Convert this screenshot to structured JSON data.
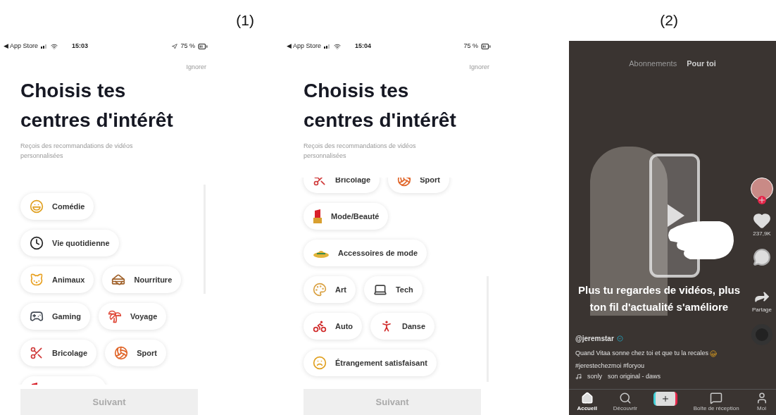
{
  "figure_labels": [
    "(1)",
    "(2)"
  ],
  "screens": [
    {
      "status": {
        "carrier": "◀ App Store",
        "time": "15:03",
        "location": true,
        "battery": "75 %"
      },
      "skip": "Ignorer",
      "title": [
        "Choisis tes",
        "centres d'intérêt"
      ],
      "subtitle": "Reçois des recommandations de vidéos personnalisées",
      "scrolled": false,
      "rows": [
        [
          {
            "label": "Comédie",
            "kind": "laugh"
          }
        ],
        [
          {
            "label": "Vie quotidienne",
            "kind": "clock"
          }
        ],
        [
          {
            "label": "Animaux",
            "kind": "cat"
          },
          {
            "label": "Nourriture",
            "kind": "burger"
          }
        ],
        [
          {
            "label": "Gaming",
            "kind": "gamepad"
          },
          {
            "label": "Voyage",
            "kind": "beach"
          }
        ],
        [
          {
            "label": "Bricolage",
            "kind": "scissors"
          },
          {
            "label": "Sport",
            "kind": "ball"
          }
        ],
        [
          {
            "kind": "lipstick"
          }
        ]
      ],
      "next": "Suivant"
    },
    {
      "status": {
        "carrier": "◀ App Store",
        "time": "15:04",
        "location": false,
        "battery": "75 %"
      },
      "skip": "Ignorer",
      "title": [
        "Choisis tes",
        "centres d'intérêt"
      ],
      "subtitle": "Reçois des recommandations de vidéos personnalisées",
      "scrolled": true,
      "rows": [
        [
          {
            "label": "Bricolage",
            "kind": "scissors"
          },
          {
            "label": "Sport",
            "kind": "ball"
          }
        ],
        [
          {
            "label": "Mode/Beauté",
            "kind": "lipstick"
          }
        ],
        [
          {
            "label": "Accessoires de mode",
            "kind": "hat"
          }
        ],
        [
          {
            "label": "Art",
            "kind": "palette"
          },
          {
            "label": "Tech",
            "kind": "laptop"
          }
        ],
        [
          {
            "label": "Auto",
            "kind": "motorbike"
          },
          {
            "label": "Danse",
            "kind": "dancer"
          }
        ],
        [
          {
            "label": "Étrangement satisfaisant",
            "kind": "shock"
          }
        ]
      ],
      "next": "Suivant"
    }
  ],
  "video": {
    "tabs": [
      {
        "label": "Abonnements",
        "selected": false
      },
      {
        "label": "Pour toi",
        "selected": true
      }
    ],
    "likes": "237,9K",
    "share": "Partage",
    "hint": "Plus tu regardes de vidéos, plus ton fil d'actualité s'améliore",
    "user": "@jeremstar",
    "caption_start": "Quand Vitaa sonne chez toi et que tu la recales",
    "caption_tags": "#jerestechezmoi #foryou",
    "music_user": "sonly",
    "music_title": "son original - daws",
    "nav": [
      {
        "label": "Accueil",
        "kind": "home",
        "selected": true
      },
      {
        "label": "Découvrir",
        "kind": "search",
        "selected": false
      },
      {
        "kind": "plus"
      },
      {
        "label": "Boîte de réception",
        "kind": "inbox",
        "selected": false
      },
      {
        "label": "Moi",
        "kind": "profile",
        "selected": false
      }
    ]
  }
}
